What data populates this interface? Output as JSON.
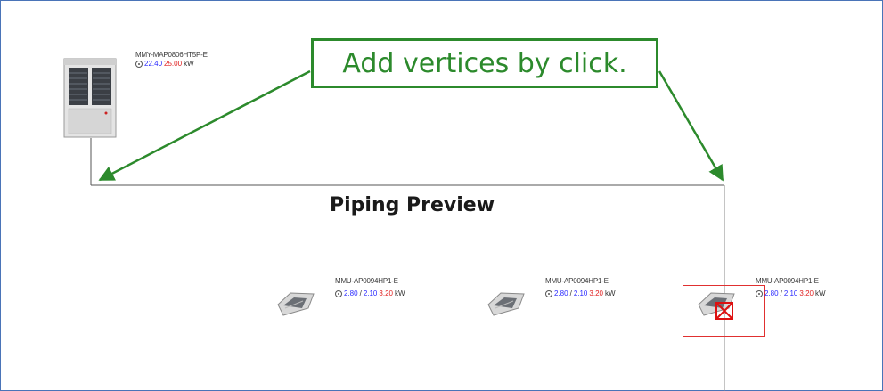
{
  "callout": {
    "text": "Add vertices by click."
  },
  "preview_title": "Piping Preview",
  "outdoor_unit": {
    "model": "MMY-MAP0806HT5P-E",
    "cooling_kw": "22.40",
    "heating_kw": "25.00",
    "unit": "kW",
    "icon": "outdoor-condenser-icon"
  },
  "indoor_units": [
    {
      "model": "MMU-AP0094HP1-E",
      "v1": "2.80",
      "sep": "/",
      "v2": "2.10",
      "v3": "3.20",
      "unit": "kW",
      "icon": "ceiling-cassette-icon"
    },
    {
      "model": "MMU-AP0094HP1-E",
      "v1": "2.80",
      "sep": "/",
      "v2": "2.10",
      "v3": "3.20",
      "unit": "kW",
      "icon": "ceiling-cassette-icon"
    },
    {
      "model": "MMU-AP0094HP1-E",
      "v1": "2.80",
      "sep": "/",
      "v2": "2.10",
      "v3": "3.20",
      "unit": "kW",
      "icon": "ceiling-cassette-icon"
    }
  ],
  "colors": {
    "callout_green": "#2c8a2c",
    "cooling_blue": "#2a2aff",
    "heating_red": "#e02020",
    "selection_red": "#e03030",
    "frame_border": "#4a74b8",
    "pipe": "#555555"
  }
}
